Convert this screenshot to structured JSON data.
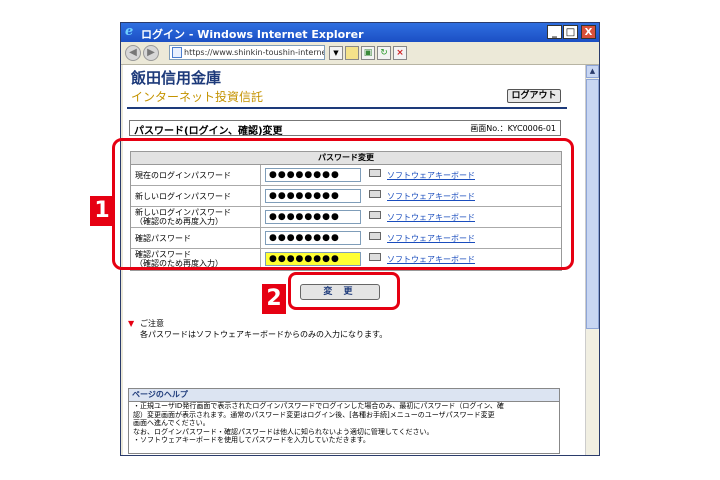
{
  "window": {
    "title": "ログイン - Windows Internet Explorer",
    "url": "https://www.shinkin-toushin-internet.jp",
    "controls": {
      "minimize": "_",
      "maximize": "□",
      "close": "X"
    }
  },
  "header": {
    "bank_name": "飯田信用金庫",
    "service_name": "インターネット投資信託",
    "logout_label": "ログアウト"
  },
  "page": {
    "title": "パスワード(ログイン、確認)変更",
    "screen_id": "画面No.：KYC0006-01"
  },
  "form": {
    "table_header": "パスワード変更",
    "link_label": "ソフトウェアキーボード",
    "rows": [
      {
        "label": "現在のログインパスワード",
        "value": "●●●●●●●●",
        "highlight": false
      },
      {
        "label": "新しいログインパスワード",
        "value": "●●●●●●●●",
        "highlight": false
      },
      {
        "label": "新しいログインパスワード\n（確認のため再度入力）",
        "value": "●●●●●●●●",
        "highlight": false
      },
      {
        "label": "確認パスワード",
        "value": "●●●●●●●●",
        "highlight": false
      },
      {
        "label": "確認パスワード\n（確認のため再度入力）",
        "value": "●●●●●●●●",
        "highlight": true
      }
    ],
    "submit_label": "変 更"
  },
  "annotations": {
    "marker1": "1",
    "marker2": "2",
    "color": "#e60012"
  },
  "notice": {
    "heading": "ご注意",
    "body": "各パスワードはソフトウェアキーボードからのみの入力になります。"
  },
  "help": {
    "heading": "ページのヘルプ",
    "lines": [
      "・正規ユーザID発行画面で表示されたログインパスワードでログインした場合のみ、最初にパスワード（ログイン、確",
      "  認）変更画面が表示されます。通常のパスワード変更はログイン後、[各種お手続]メニューのユーザパスワード変更",
      "  画面へ進んでください。",
      "  なお、ログインパスワード・確認パスワードは他人に知られないよう適切に管理してください。",
      "・ソフトウェアキーボードを使用してパスワードを入力していただきます。"
    ]
  }
}
